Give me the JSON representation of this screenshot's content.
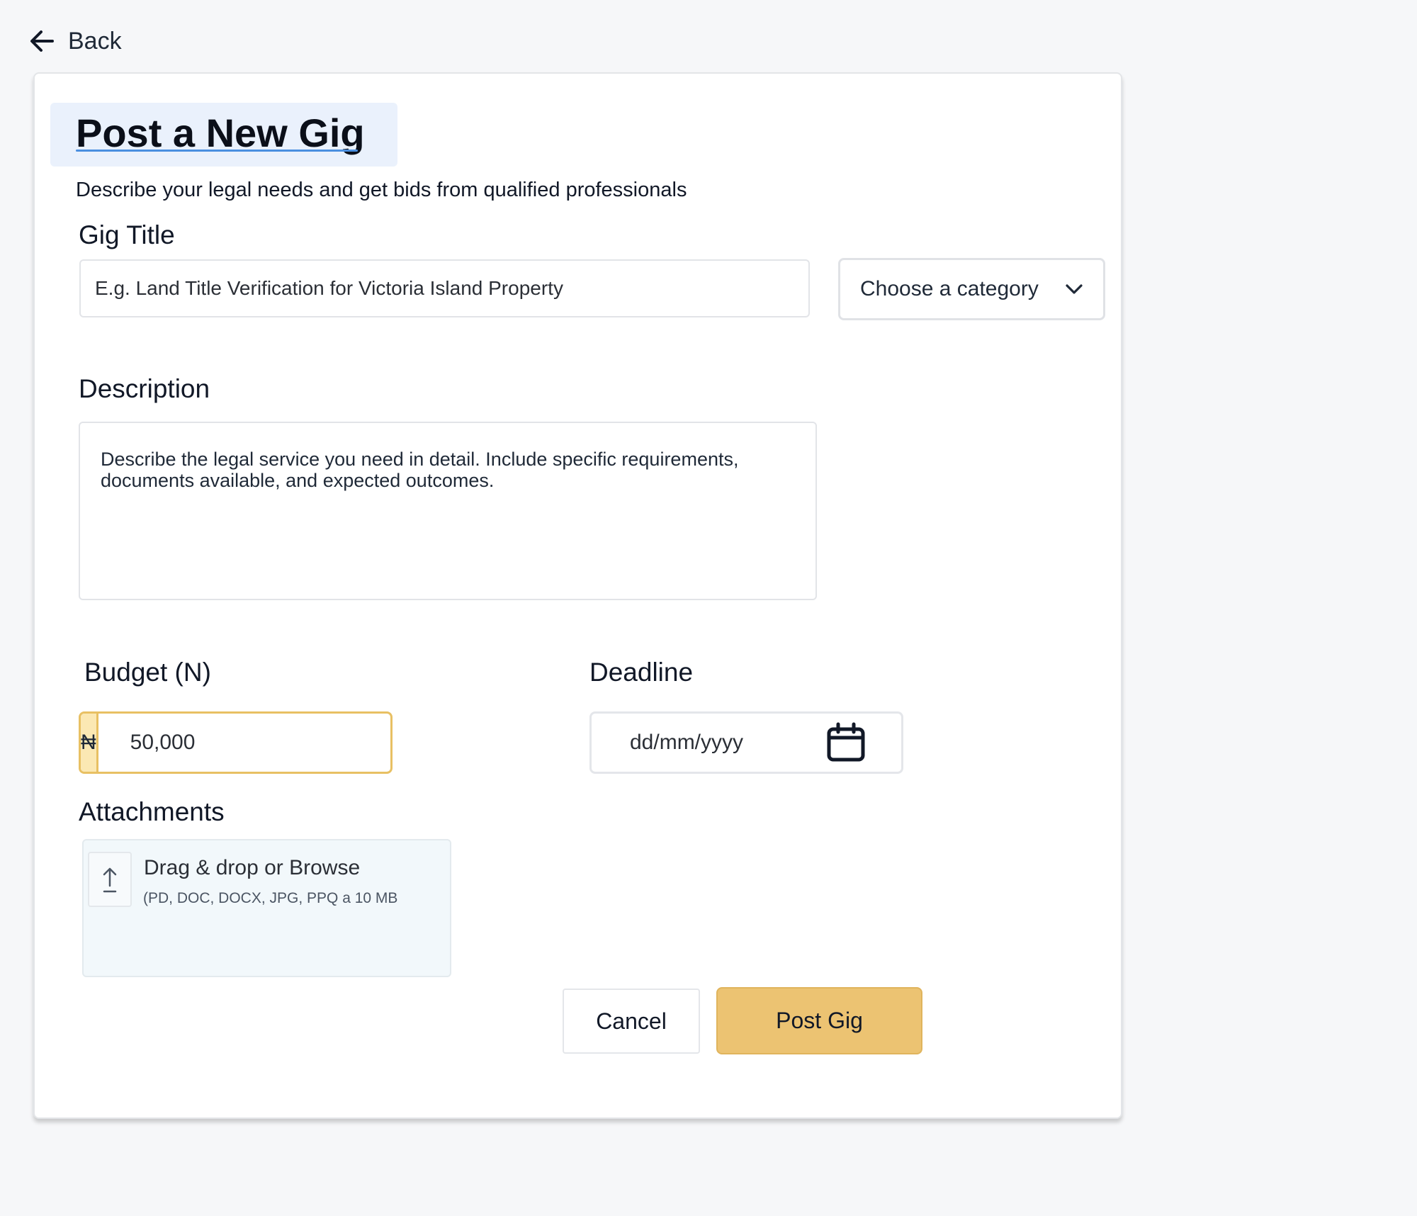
{
  "nav": {
    "back_label": "Back",
    "back_icon": "arrow-left-icon"
  },
  "header": {
    "title": "Post a New Gig",
    "subtitle": "Describe your legal needs and get bids from qualified professionals"
  },
  "form": {
    "gig_title": {
      "label": "Gig Title",
      "placeholder": "E.g. Land Title Verification for Victoria Island Property",
      "value": ""
    },
    "category": {
      "selected": "Choose a category",
      "icon": "chevron-down-icon"
    },
    "description": {
      "label": "Description",
      "placeholder": "Describe the legal service you need in detail. Include specific requirements, documents available, and expected outcomes.",
      "value": ""
    },
    "budget": {
      "label": "Budget (N)",
      "currency_symbol": "₦",
      "value": "50,000"
    },
    "deadline": {
      "label": "Deadline",
      "placeholder": "dd/mm/yyyy",
      "icon": "calendar-icon"
    },
    "attachments": {
      "label": "Attachments",
      "dropzone_title": "Drag & drop or Browse",
      "dropzone_hint": "(PD, DOC, DOCX, JPG, PPQ a 10 MB",
      "icon": "upload-icon"
    }
  },
  "actions": {
    "cancel_label": "Cancel",
    "submit_label": "Post Gig"
  },
  "colors": {
    "page_background": "#f6f7f9",
    "accent": "#ecc372",
    "accent_border": "#e8c063",
    "currency_addon": "#fbe8b3",
    "title_highlight": "#eaf1fc",
    "title_underline": "#4a8fe0",
    "dropzone": "#f2f8fb"
  }
}
